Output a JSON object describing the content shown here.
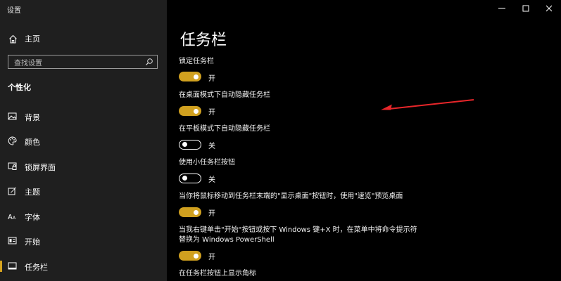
{
  "window": {
    "title": "设置",
    "controls": [
      "minimize",
      "maximize",
      "close"
    ]
  },
  "sidebar": {
    "home_label": "主页",
    "search_placeholder": "查找设置",
    "section_title": "个性化",
    "items": [
      {
        "label": "背景",
        "icon": "image-icon"
      },
      {
        "label": "颜色",
        "icon": "palette-icon"
      },
      {
        "label": "锁屏界面",
        "icon": "lock-screen-icon"
      },
      {
        "label": "主题",
        "icon": "theme-icon"
      },
      {
        "label": "字体",
        "icon": "font-icon"
      },
      {
        "label": "开始",
        "icon": "start-icon"
      },
      {
        "label": "任务栏",
        "icon": "taskbar-icon",
        "active": true
      }
    ]
  },
  "main": {
    "title": "任务栏",
    "settings": [
      {
        "label": "锁定任务栏",
        "state": "开",
        "on": true
      },
      {
        "label": "在桌面模式下自动隐藏任务栏",
        "state": "开",
        "on": true
      },
      {
        "label": "在平板模式下自动隐藏任务栏",
        "state": "关",
        "on": false
      },
      {
        "label": "使用小任务栏按钮",
        "state": "关",
        "on": false
      },
      {
        "label": "当你将鼠标移动到任务栏末端的\"显示桌面\"按钮时，使用\"速览\"预览桌面",
        "state": "开",
        "on": true
      },
      {
        "label": "当我右键单击\"开始\"按钮或按下 Windows 键+X 时，在菜单中将命令提示符替换为 Windows PowerShell",
        "state": "开",
        "on": true
      },
      {
        "label": "在任务栏按钮上显示角标"
      }
    ]
  },
  "colors": {
    "accent": "#d0a01f",
    "sidebar_bg": "#1f1f1f",
    "main_bg": "#000000",
    "arrow": "#e8262a"
  }
}
